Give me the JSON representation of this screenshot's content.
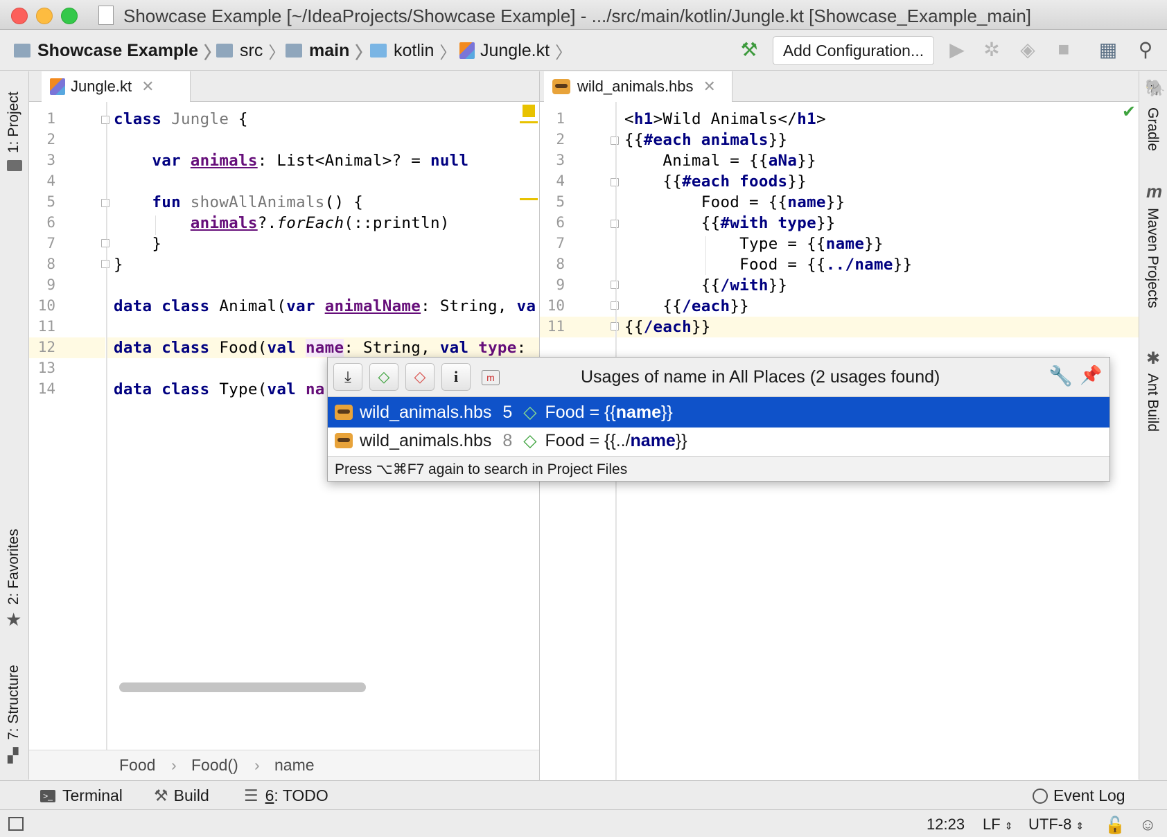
{
  "window": {
    "title": "Showcase Example [~/IdeaProjects/Showcase Example] - .../src/main/kotlin/Jungle.kt [Showcase_Example_main]"
  },
  "navbar": {
    "crumbs": [
      "Showcase Example",
      "src",
      "main",
      "kotlin",
      "Jungle.kt"
    ],
    "add_configuration": "Add Configuration..."
  },
  "left_tool_windows": [
    "1: Project",
    "2: Favorites",
    "7: Structure"
  ],
  "right_tool_windows": [
    "Gradle",
    "Maven Projects",
    "Ant Build"
  ],
  "left_editor": {
    "tab": "Jungle.kt",
    "line_numbers": [
      "1",
      "2",
      "3",
      "4",
      "5",
      "6",
      "7",
      "8",
      "9",
      "10",
      "11",
      "12",
      "13",
      "14"
    ],
    "current_line": "12",
    "breadcrumbs": [
      "Food",
      "Food()",
      "name"
    ]
  },
  "right_editor": {
    "tab": "wild_animals.hbs",
    "line_numbers": [
      "1",
      "2",
      "3",
      "4",
      "5",
      "6",
      "7",
      "8",
      "9",
      "10",
      "11"
    ],
    "current_line": "11"
  },
  "usages_popup": {
    "title": "Usages of name in All Places (2 usages found)",
    "rows": [
      {
        "file": "wild_animals.hbs",
        "line": "5",
        "text_prefix": "Food = {{",
        "text_match": "name",
        "text_suffix": "}}",
        "selected": true
      },
      {
        "file": "wild_animals.hbs",
        "line": "8",
        "text_prefix": "Food = {{../",
        "text_match": "name",
        "text_suffix": "}}",
        "selected": false
      }
    ],
    "footer": "Press ⌥⌘F7 again to search in Project Files"
  },
  "bottom_tools": {
    "terminal": "Terminal",
    "build": "Build",
    "todo_mnemonic": "6",
    "todo": ": TODO",
    "event_log": "Event Log"
  },
  "status_bar": {
    "position": "12:23",
    "line_separator": "LF",
    "encoding": "UTF-8"
  },
  "colors": {
    "selection": "#0f52c9",
    "keyword": "#000080",
    "property": "#660e7a",
    "caret_row": "#fffae3"
  }
}
